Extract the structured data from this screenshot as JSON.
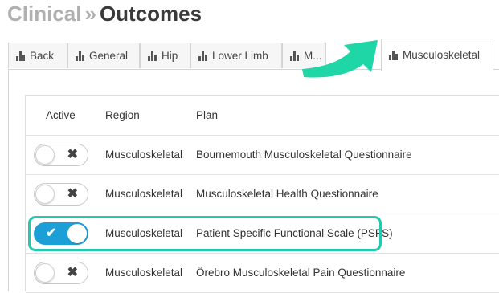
{
  "header": {
    "crumb": "Clinical",
    "separator": "»",
    "current": "Outcomes"
  },
  "tabs": [
    {
      "label": "Back"
    },
    {
      "label": "General"
    },
    {
      "label": "Hip"
    },
    {
      "label": "Lower Limb"
    },
    {
      "label": "M..."
    },
    {
      "label": "Musculoskeletal",
      "active": true
    }
  ],
  "table": {
    "columns": [
      "Active",
      "Region",
      "Plan"
    ],
    "rows": [
      {
        "active": false,
        "region": "Musculoskeletal",
        "plan": "Bournemouth Musculoskeletal Questionnaire"
      },
      {
        "active": false,
        "region": "Musculoskeletal",
        "plan": "Musculoskeletal Health Questionnaire"
      },
      {
        "active": true,
        "region": "Musculoskeletal",
        "plan": "Patient Specific Functional Scale (PSFS)"
      },
      {
        "active": false,
        "region": "Musculoskeletal",
        "plan": "Örebro Musculoskeletal Pain Questionnaire"
      }
    ]
  },
  "colors": {
    "toggle_on": "#1c9fd6",
    "highlight": "#23c9ad",
    "arrow": "#1fd6a6"
  },
  "icons": {
    "tab_icon": "bar-chart-icon",
    "toggle_off_mark": "close-icon",
    "toggle_on_mark": "check-icon"
  }
}
